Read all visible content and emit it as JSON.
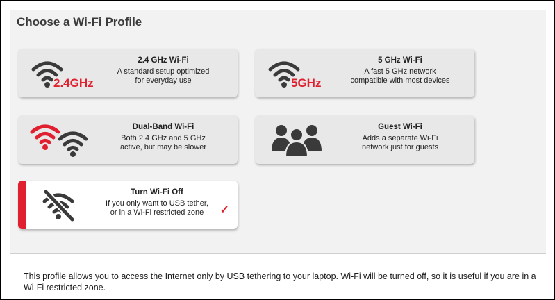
{
  "page": {
    "title": "Choose a Wi-Fi Profile"
  },
  "profiles": [
    {
      "name": "2.4 GHz Wi-Fi",
      "desc": "A standard setup optimized\nfor everyday use",
      "badge": "2.4GHz"
    },
    {
      "name": "5 GHz Wi-Fi",
      "desc": "A fast 5 GHz network\ncompatible with most devices",
      "badge": "5GHz"
    },
    {
      "name": "Dual-Band Wi-Fi",
      "desc": "Both 2.4 GHz and 5 GHz\nactive, but may be slower"
    },
    {
      "name": "Guest Wi-Fi",
      "desc": "Adds a separate Wi-Fi\nnetwork just for guests"
    },
    {
      "name": "Turn Wi-Fi Off",
      "desc": "If you only want to USB tether,\nor in a Wi-Fi restricted zone",
      "selected": true,
      "check": "✓"
    }
  ],
  "description": "This profile allows you to access the Internet only by USB tethering to your laptop. Wi-Fi will be turned off, so it is useful if you are in a Wi-Fi restricted zone.",
  "colors": {
    "accent": "#e0202e",
    "icon_gray": "#3a3a3a",
    "card": "#e8e8e8",
    "panel": "#f2f2f2"
  }
}
